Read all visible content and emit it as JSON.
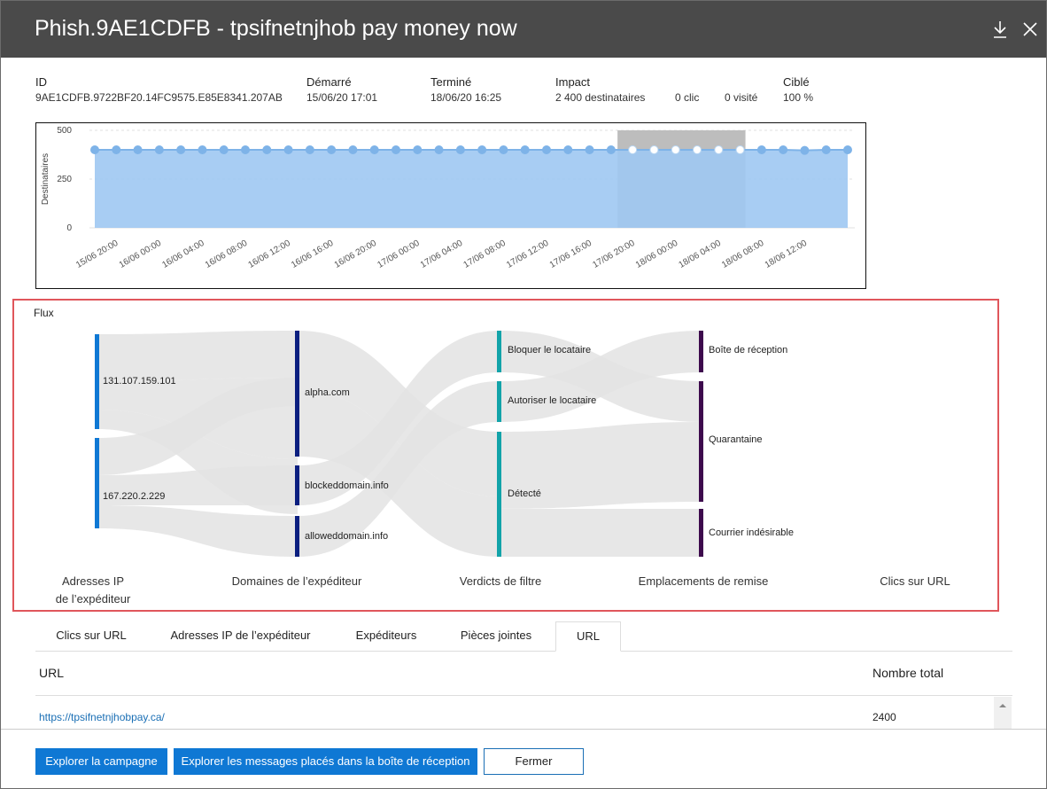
{
  "header": {
    "title": "Phish.9AE1CDFB - tpsifnetnjhob pay money now",
    "download_icon": "download-icon",
    "close_icon": "close-icon"
  },
  "meta": {
    "id_label": "ID",
    "id_value": "9AE1CDFB.9722BF20.14FC9575.E85E8341.207AB",
    "start_label": "Démarré",
    "start_value": "15/06/20 17:01",
    "end_label": "Terminé",
    "end_value": "18/06/20 16:25",
    "impact_label": "Impact",
    "impact_recipients": "2 400 destinataires",
    "impact_clicks": "0 clic",
    "impact_visits": "0 visité",
    "target_label": "Ciblé",
    "target_value": "100 %"
  },
  "chart_data": {
    "type": "area",
    "ylabel": "Destinataires",
    "ylim": [
      0,
      500
    ],
    "yticks": [
      "500",
      "250",
      "0"
    ],
    "xtick_labels": [
      "15/06 20:00",
      "16/06 00:00",
      "16/06 04:00",
      "16/06 08:00",
      "16/06 12:00",
      "16/06 16:00",
      "16/06 20:00",
      "17/06 00:00",
      "17/06 04:00",
      "17/06 08:00",
      "17/06 12:00",
      "17/06 16:00",
      "17/06 20:00",
      "18/06 00:00",
      "18/06 04:00",
      "18/06 08:00",
      "18/06 12:00"
    ],
    "values": [
      400,
      400,
      400,
      400,
      400,
      400,
      400,
      400,
      400,
      400,
      400,
      400,
      400,
      400,
      400,
      400,
      400,
      400,
      400,
      400,
      400,
      400,
      400,
      400,
      400,
      400,
      400,
      400,
      400,
      400,
      400,
      400,
      400,
      397,
      400,
      400
    ],
    "highlight_index_range": [
      25,
      30
    ],
    "colors": {
      "area": "#9ec8f2",
      "line": "#7eb3e8",
      "highlight": "#bdbdbd"
    }
  },
  "flow": {
    "title": "Flux",
    "columns": [
      "Adresses IP\nde l’expéditeur",
      "Domaines de l’expéditeur",
      "Verdicts de filtre",
      "Emplacements de remise",
      "Clics sur URL"
    ],
    "nodes": {
      "ip1": "131.107.159.101",
      "ip2": "167.220.2.229",
      "d1": "alpha.com",
      "d2": "blockeddomain.info",
      "d3": "alloweddomain.info",
      "v1": "Bloquer le locataire",
      "v2": "Autoriser le locataire",
      "v3": "Détecté",
      "l1": "Boîte de réception",
      "l2": "Quarantaine",
      "l3": "Courrier indésirable"
    },
    "colors": {
      "ip": "#0f78d4",
      "domain": "#0b1f80",
      "verdict": "#12a3a9",
      "location": "#3d0a4d",
      "link": "#e3e3e3"
    }
  },
  "tabs": [
    "Clics sur URL",
    "Adresses IP de l’expéditeur",
    "Expéditeurs",
    "Pièces jointes",
    "URL"
  ],
  "active_tab": 4,
  "table": {
    "col_url": "URL",
    "col_total": "Nombre total",
    "rows": [
      {
        "url": "https://tpsifnetnjhobpay.ca/",
        "total": "2400"
      }
    ]
  },
  "footer": {
    "explore_campaign": "Explorer la campagne",
    "explore_messages": "Explorer les messages placés dans la boîte de réception",
    "close": "Fermer"
  }
}
